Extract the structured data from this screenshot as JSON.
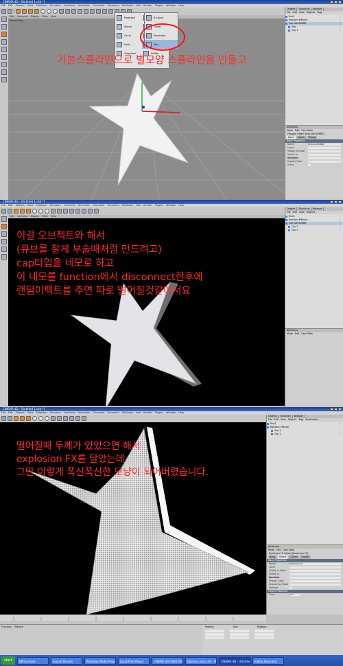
{
  "colors": {
    "annotation": "#ff2a2a",
    "viewport_grey": "#8c8c8c",
    "viewport_black": "#000000",
    "star_fill": "#e8e8ec",
    "title_blue": "#2d58b2",
    "accent_orange": "#e28b2a"
  },
  "app": {
    "title_1": "CINEMA 4D - [Untitled 1.c4d *]",
    "title_2": "CINEMA 4D - [Untitled 1.c4d *]",
    "title_3": "CINEMA 4D - [Untitled 1.c4d *]"
  },
  "menu": [
    "File",
    "Edit",
    "Objects",
    "Tools",
    "Selection",
    "Structure",
    "Functions",
    "Animation",
    "Character",
    "Dynamics",
    "MoGraph",
    "Hair",
    "Render",
    "Plugins",
    "Window",
    "Help"
  ],
  "viewport_menu": [
    "Edit",
    "Cameras",
    "Display",
    "Filter",
    "View"
  ],
  "viewport_label": "Perspective",
  "spline_menu": {
    "items": [
      "Freehand",
      "Bezier",
      "B-Spline",
      "Linear",
      "Cubic",
      "Akima",
      "Circle",
      "Rectangle",
      "Helix",
      "Star",
      "Cogwheel",
      "Profile"
    ],
    "highlighted": "Star"
  },
  "object_manager": {
    "tabs": [
      "Objects",
      "Structure",
      "Browser"
    ],
    "menu": [
      "File",
      "Edit",
      "View",
      "Objects",
      "Tags",
      "Bookmarks"
    ],
    "panel1_items": [
      "Rnd1",
      "Random Effector",
      "Extrude NURBS",
      "Star",
      "Cap 1"
    ],
    "panel2_items": [
      "Rnd1",
      "Random Effector",
      "Extrude NURBS",
      "Cap 1",
      "Cap 2"
    ],
    "panel3_items": [
      "Rnd1",
      "Random Effector",
      "Cap 1",
      "Cap 2"
    ]
  },
  "attributes": {
    "header": "Attributes",
    "menu": [
      "Mode",
      "Edit",
      "User Data"
    ],
    "object_1": "Polygon Object [Extrude NURBS]",
    "object_3": "Explosion FX Object [Explosion FX]",
    "tabs_1": [
      "Basic",
      "Coord.",
      "Phong"
    ],
    "tabs_3": [
      "Basic",
      "Object",
      "Cluster",
      "Gravity",
      "Rotation",
      "Wind"
    ],
    "section": "Basic Properties",
    "section_3b": "Object Properties",
    "rows": [
      "Name",
      "Layer",
      "Visible in Editor",
      "Visible in Renderer",
      "Use Color",
      "Display Color",
      "X-Ray"
    ],
    "rows_3": [
      "Name",
      "Layer",
      "Visible in Editor",
      "Visible in Renderer",
      "Use Color",
      "Display Color",
      "Shaded Iso Mode",
      "Enabled"
    ],
    "name_value_1": "Extrude NURBS",
    "name_value_3": "Explosion FX",
    "time_label": "Time",
    "time_value": "0 %"
  },
  "bottom_tabs": [
    "Function",
    "Texture"
  ],
  "coords": {
    "headers": [
      "Position",
      "Size",
      "Rotation"
    ]
  },
  "annotations": {
    "text1": "기본스플라인으로 별모양 스플라인을 만들고",
    "text2": "이걸 오브젝트와 해서\n(큐브를 잘게 부술때처럼 만드려고)\ncap타입을 네모로 하고\n이 네모를 function에서 disconnect한후에\n랜덤이펙트를 주면 따로 떨어질것같아서요",
    "text3": "떨어질때 두께가 있었으면 해서\nexplosion FX를 달았는데\n그만 이렇게 폭신폭신한 모냥이 되어버렸습니다."
  },
  "taskbar": {
    "start": "start",
    "items": [
      "NWI sample",
      "Search Results",
      "Windows Media Player",
      "QuickTime Player",
      "CINEMA 4D USER GROUP...",
      "Opera is your Life - MIC...",
      "CINEMA 4D - [Untitled...",
      "Adobe Illustrator"
    ],
    "active_index": 6
  }
}
